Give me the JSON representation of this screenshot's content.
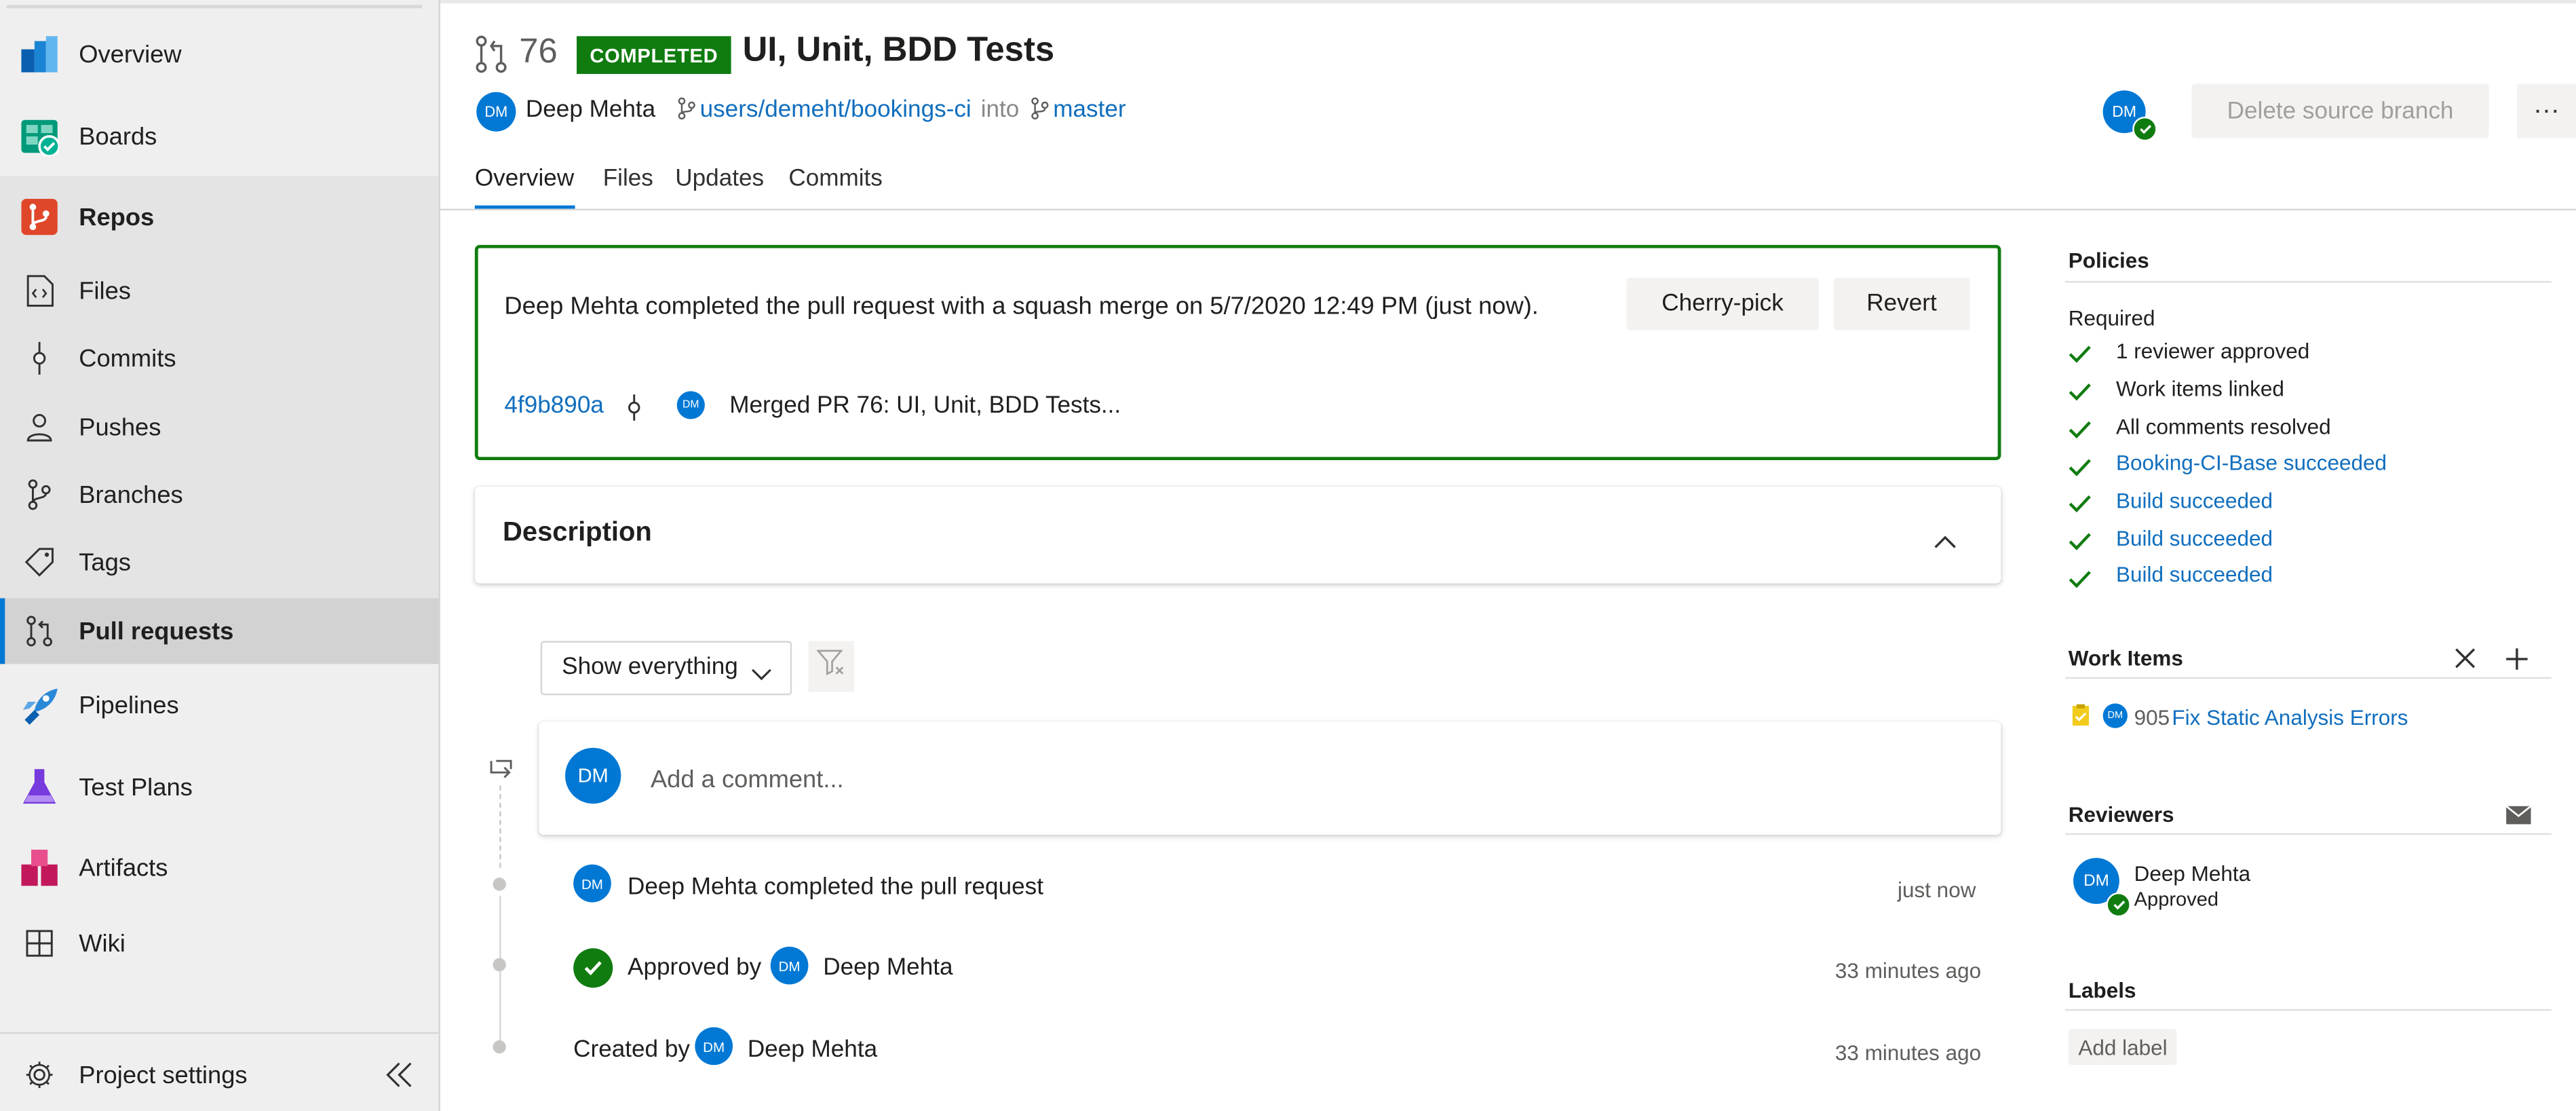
{
  "sidebar": {
    "items": [
      {
        "label": "Overview",
        "icon": "overview-icon"
      },
      {
        "label": "Boards",
        "icon": "boards-icon"
      },
      {
        "label": "Repos",
        "icon": "repos-icon"
      },
      {
        "label": "Files",
        "icon": "files-icon"
      },
      {
        "label": "Commits",
        "icon": "commits-icon"
      },
      {
        "label": "Pushes",
        "icon": "pushes-icon"
      },
      {
        "label": "Branches",
        "icon": "branches-icon"
      },
      {
        "label": "Tags",
        "icon": "tags-icon"
      },
      {
        "label": "Pull requests",
        "icon": "pull-request-icon"
      },
      {
        "label": "Pipelines",
        "icon": "pipelines-icon"
      },
      {
        "label": "Test Plans",
        "icon": "test-plans-icon"
      },
      {
        "label": "Artifacts",
        "icon": "artifacts-icon"
      },
      {
        "label": "Wiki",
        "icon": "wiki-icon"
      }
    ],
    "settings_label": "Project settings",
    "collapse_icon": "double-chevron-left-icon"
  },
  "header": {
    "pr_number": "76",
    "status": "COMPLETED",
    "title": "UI, Unit, BDD Tests",
    "author_initials": "DM",
    "author": "Deep Mehta",
    "source_branch": "users/demeht/bookings-ci",
    "into": "into",
    "target_branch": "master",
    "reviewer_initials": "DM",
    "delete_branch_label": "Delete source branch",
    "more_label": "···",
    "tabs": [
      "Overview",
      "Files",
      "Updates",
      "Commits"
    ],
    "active_tab": "Overview"
  },
  "completion": {
    "message": "Deep Mehta completed the pull request with a squash merge on 5/7/2020 12:49 PM (just now).",
    "cherry_pick_label": "Cherry-pick",
    "revert_label": "Revert",
    "commit_hash": "4f9b890a",
    "merge_avatar_initials": "DM",
    "merge_message": "Merged PR 76: UI, Unit, BDD Tests..."
  },
  "description": {
    "title": "Description"
  },
  "activity": {
    "filter_label": "Show everything",
    "comment_avatar_initials": "DM",
    "comment_placeholder": "Add a comment...",
    "events": [
      {
        "initials": "DM",
        "text": "Deep Mehta completed the pull request",
        "time": "just now"
      },
      {
        "prefix": "Approved by",
        "initials": "DM",
        "name": "Deep Mehta",
        "time": "33 minutes ago"
      },
      {
        "prefix": "Created by",
        "initials": "DM",
        "name": "Deep Mehta",
        "time": "33 minutes ago"
      }
    ]
  },
  "policies": {
    "title": "Policies",
    "required_label": "Required",
    "items": [
      {
        "text": "1 reviewer approved",
        "link": false
      },
      {
        "text": "Work items linked",
        "link": false
      },
      {
        "text": "All comments resolved",
        "link": false
      },
      {
        "text": "Booking-CI-Base succeeded",
        "link": true
      },
      {
        "text": "Build succeeded",
        "link": true
      },
      {
        "text": "Build succeeded",
        "link": true
      },
      {
        "text": "Build succeeded",
        "link": true
      }
    ]
  },
  "work_items": {
    "title": "Work Items",
    "item_initials": "DM",
    "item_id": "905",
    "item_title": "Fix Static Analysis Errors"
  },
  "reviewers": {
    "title": "Reviewers",
    "initials": "DM",
    "name": "Deep Mehta",
    "status": "Approved"
  },
  "labels": {
    "title": "Labels",
    "add_label": "Add label"
  },
  "colors": {
    "accent": "#0078d4",
    "success": "#107c10",
    "link": "#106ebe"
  }
}
